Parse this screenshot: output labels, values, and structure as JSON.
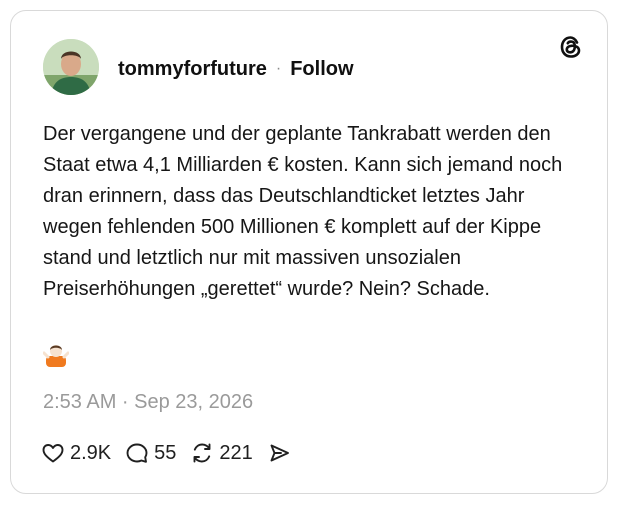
{
  "post": {
    "username": "tommyforfuture",
    "separator": "·",
    "follow_label": "Follow",
    "text": "Der vergangene und der geplante Tankrabatt werden den Staat etwa 4,1 Milliarden € kosten. Kann sich jemand noch dran erinnern, dass das Deutschlandticket letztes Jahr wegen fehlenden 500 Millionen € komplett auf der Kippe stand und letztlich nur mit massiven unsozialen Preiserhöhungen „gerettet“ wurde? Nein? Schade.",
    "emoji_icon": "person-shrugging-emoji",
    "timestamp": "2:53 AM · Sep 23, 2026"
  },
  "actions": {
    "likes": "2.9K",
    "replies": "55",
    "reposts": "221"
  },
  "icons": {
    "brand": "threads-logo-icon",
    "like": "heart-icon",
    "reply": "comment-icon",
    "repost": "repost-icon",
    "share": "share-icon"
  }
}
